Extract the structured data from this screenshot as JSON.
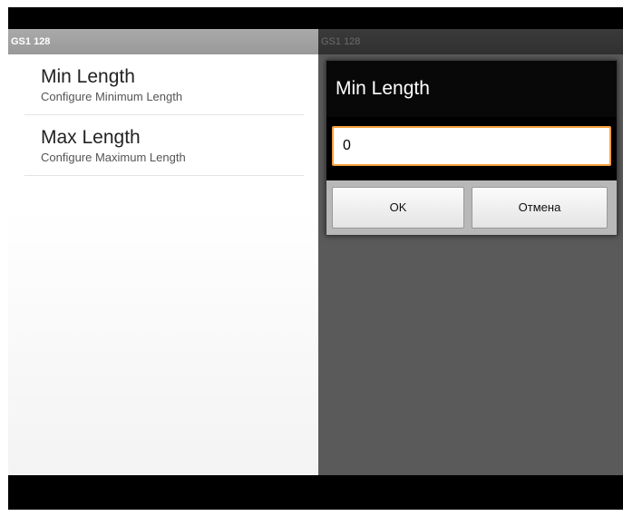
{
  "app": {
    "title": "GS1 128"
  },
  "preferences": [
    {
      "title": "Min Length",
      "summary": "Configure Minimum Length"
    },
    {
      "title": "Max Length",
      "summary": "Configure Maximum Length"
    }
  ],
  "dialog": {
    "title": "Min Length",
    "input_value": "0",
    "ok_label": "OK",
    "cancel_label": "Отмена"
  },
  "colors": {
    "input_focus_border": "#f5a03c",
    "titlebar_bg": "#aaaaaa",
    "dim_overlay": "#5a5a5a"
  }
}
